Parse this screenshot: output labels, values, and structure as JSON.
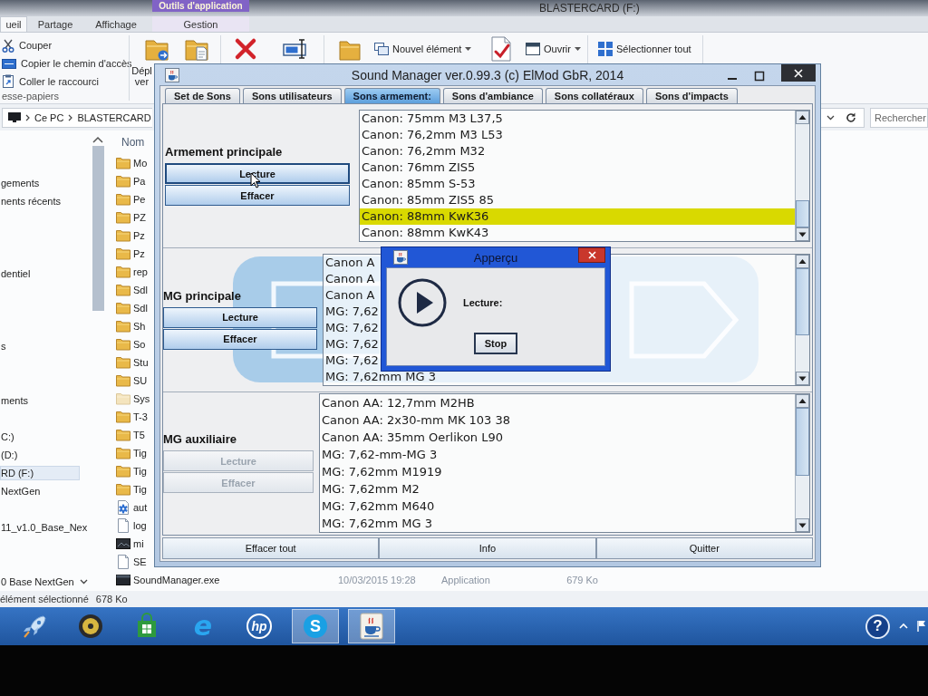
{
  "explorer": {
    "context_group": "Outils d'application",
    "title": "BLASTERCARD (F:)",
    "ribbon_tabs": [
      {
        "label": "ueil",
        "selected": true
      },
      {
        "label": "Partage",
        "selected": false
      },
      {
        "label": "Affichage",
        "selected": false
      },
      {
        "label": "Gestion",
        "selected": false
      }
    ],
    "clipboard": {
      "commands": [
        "Couper",
        "Copier le chemin d'accès",
        "Coller le raccourci"
      ],
      "group_label": "esse-papiers"
    },
    "move_to": [
      "Dépl",
      "ver"
    ],
    "new_item": "Nouvel élément",
    "open": "Ouvrir",
    "select_all": "Sélectionner tout",
    "breadcrumbs": [
      "Ce PC",
      "BLASTERCARD"
    ],
    "search": {
      "placeholder": "Rechercher"
    },
    "nav_items": [
      {
        "label": "gements",
        "kind": "location",
        "selected": false
      },
      {
        "label": "nents récents",
        "kind": "location",
        "selected": false
      },
      {
        "label": "dentiel",
        "kind": "location",
        "selected": false
      },
      {
        "label": "s",
        "kind": "location",
        "selected": false
      },
      {
        "label": "ments",
        "kind": "location",
        "selected": false
      },
      {
        "label": "C:)",
        "kind": "location",
        "selected": false
      },
      {
        "label": "(D:)",
        "kind": "location",
        "selected": false
      },
      {
        "label": "RD (F:)",
        "kind": "location",
        "selected": true
      },
      {
        "label": "NextGen",
        "kind": "location",
        "selected": false
      },
      {
        "label": "11_v1.0_Base_Nex",
        "kind": "location",
        "selected": false
      },
      {
        "label": "0 Base NextGen",
        "kind": "group",
        "selected": false
      }
    ],
    "column_header": "Nom",
    "files": [
      {
        "name": "Mo",
        "kind": "folder"
      },
      {
        "name": "Pa",
        "kind": "folder"
      },
      {
        "name": "Pe",
        "kind": "folder"
      },
      {
        "name": "PZ",
        "kind": "folder"
      },
      {
        "name": "Pz",
        "kind": "folder"
      },
      {
        "name": "Pz",
        "kind": "folder"
      },
      {
        "name": "rep",
        "kind": "folder"
      },
      {
        "name": "Sdl",
        "kind": "folder"
      },
      {
        "name": "Sdl",
        "kind": "folder"
      },
      {
        "name": "Sh",
        "kind": "folder"
      },
      {
        "name": "So",
        "kind": "folder"
      },
      {
        "name": "Stu",
        "kind": "folder"
      },
      {
        "name": "SU",
        "kind": "folder"
      },
      {
        "name": "Sys",
        "kind": "hidden_folder"
      },
      {
        "name": "T-3",
        "kind": "folder"
      },
      {
        "name": "T5",
        "kind": "folder"
      },
      {
        "name": "Tig",
        "kind": "folder"
      },
      {
        "name": "Tig",
        "kind": "folder"
      },
      {
        "name": "Tig",
        "kind": "folder"
      },
      {
        "name": "aut",
        "kind": "settings"
      },
      {
        "name": "log",
        "kind": "document"
      },
      {
        "name": "mi",
        "kind": "picture"
      },
      {
        "name": "SE",
        "kind": "document"
      },
      {
        "name": "SoundManager.exe",
        "kind": "program",
        "date": "10/03/2015 19:28",
        "type": "Application",
        "size": "679 Ko"
      }
    ],
    "status": {
      "selection": "élément sélectionné",
      "size": "678 Ko"
    }
  },
  "sound_manager": {
    "title": "Sound Manager ver.0.99.3 (c) ElMod GbR, 2014",
    "tabs": [
      {
        "label": "Set de Sons",
        "selected": false
      },
      {
        "label": "Sons utilisateurs",
        "selected": false
      },
      {
        "label": "Sons armement:",
        "selected": true
      },
      {
        "label": "Sons d'ambiance",
        "selected": false
      },
      {
        "label": "Sons collatéraux",
        "selected": false
      },
      {
        "label": "Sons d'impacts",
        "selected": false
      }
    ],
    "sections": [
      {
        "label": "Armement principale",
        "buttons": [
          {
            "label": "Lecture",
            "disabled": false,
            "focused": true
          },
          {
            "label": "Effacer",
            "disabled": false,
            "focused": false
          }
        ],
        "items": [
          {
            "text": "Canon: 75mm M3 L37,5",
            "selected": false
          },
          {
            "text": "Canon: 76,2mm M3 L53",
            "selected": false
          },
          {
            "text": "Canon: 76,2mm M32",
            "selected": false
          },
          {
            "text": "Canon: 76mm ZIS5",
            "selected": false
          },
          {
            "text": "Canon: 85mm S-53",
            "selected": false
          },
          {
            "text": "Canon: 85mm ZIS5 85",
            "selected": false
          },
          {
            "text": "Canon: 88mm KwK36",
            "selected": true
          },
          {
            "text": "Canon: 88mm KwK43",
            "selected": false
          }
        ]
      },
      {
        "label": "MG principale",
        "buttons": [
          {
            "label": "Lecture",
            "disabled": false,
            "focused": false
          },
          {
            "label": "Effacer",
            "disabled": false,
            "focused": false
          }
        ],
        "items": [
          {
            "text": "Canon A",
            "selected": false
          },
          {
            "text": "Canon A",
            "selected": false
          },
          {
            "text": "Canon A",
            "selected": false
          },
          {
            "text": "MG: 7,62",
            "selected": false
          },
          {
            "text": "MG: 7,62",
            "selected": false
          },
          {
            "text": "MG: 7,62",
            "selected": false
          },
          {
            "text": "MG: 7,62",
            "selected": false
          },
          {
            "text": "MG: 7,62mm MG 3",
            "selected": false
          }
        ]
      },
      {
        "label": "MG auxiliaire",
        "buttons": [
          {
            "label": "Lecture",
            "disabled": true,
            "focused": false
          },
          {
            "label": "Effacer",
            "disabled": true,
            "focused": false
          }
        ],
        "items": [
          {
            "text": "Canon AA: 12,7mm M2HB",
            "selected": false
          },
          {
            "text": "Canon AA: 2x30-mm MK 103 38",
            "selected": false
          },
          {
            "text": "Canon AA: 35mm Oerlikon L90",
            "selected": false
          },
          {
            "text": "MG: 7,62-mm-MG 3",
            "selected": false
          },
          {
            "text": "MG: 7,62mm M1919",
            "selected": false
          },
          {
            "text": "MG: 7,62mm M2",
            "selected": false
          },
          {
            "text": "MG: 7,62mm M640",
            "selected": false
          },
          {
            "text": "MG: 7,62mm MG 3",
            "selected": false
          }
        ]
      }
    ],
    "footer_buttons": [
      "Effacer tout",
      "Info",
      "Quitter"
    ]
  },
  "preview_dialog": {
    "title": "Apperçu",
    "status_label": "Lecture:",
    "button": "Stop"
  },
  "taskbar": {
    "apps": [
      {
        "kind": "rocket",
        "active": false
      },
      {
        "kind": "disc",
        "active": false
      },
      {
        "kind": "store",
        "active": false
      },
      {
        "kind": "e_logo",
        "glyph": "e",
        "active": false
      },
      {
        "kind": "hp_logo",
        "glyph": "hp",
        "active": false
      },
      {
        "kind": "s_logo",
        "glyph": "S",
        "active": true
      },
      {
        "kind": "cup",
        "active": true
      }
    ],
    "help": "?"
  }
}
